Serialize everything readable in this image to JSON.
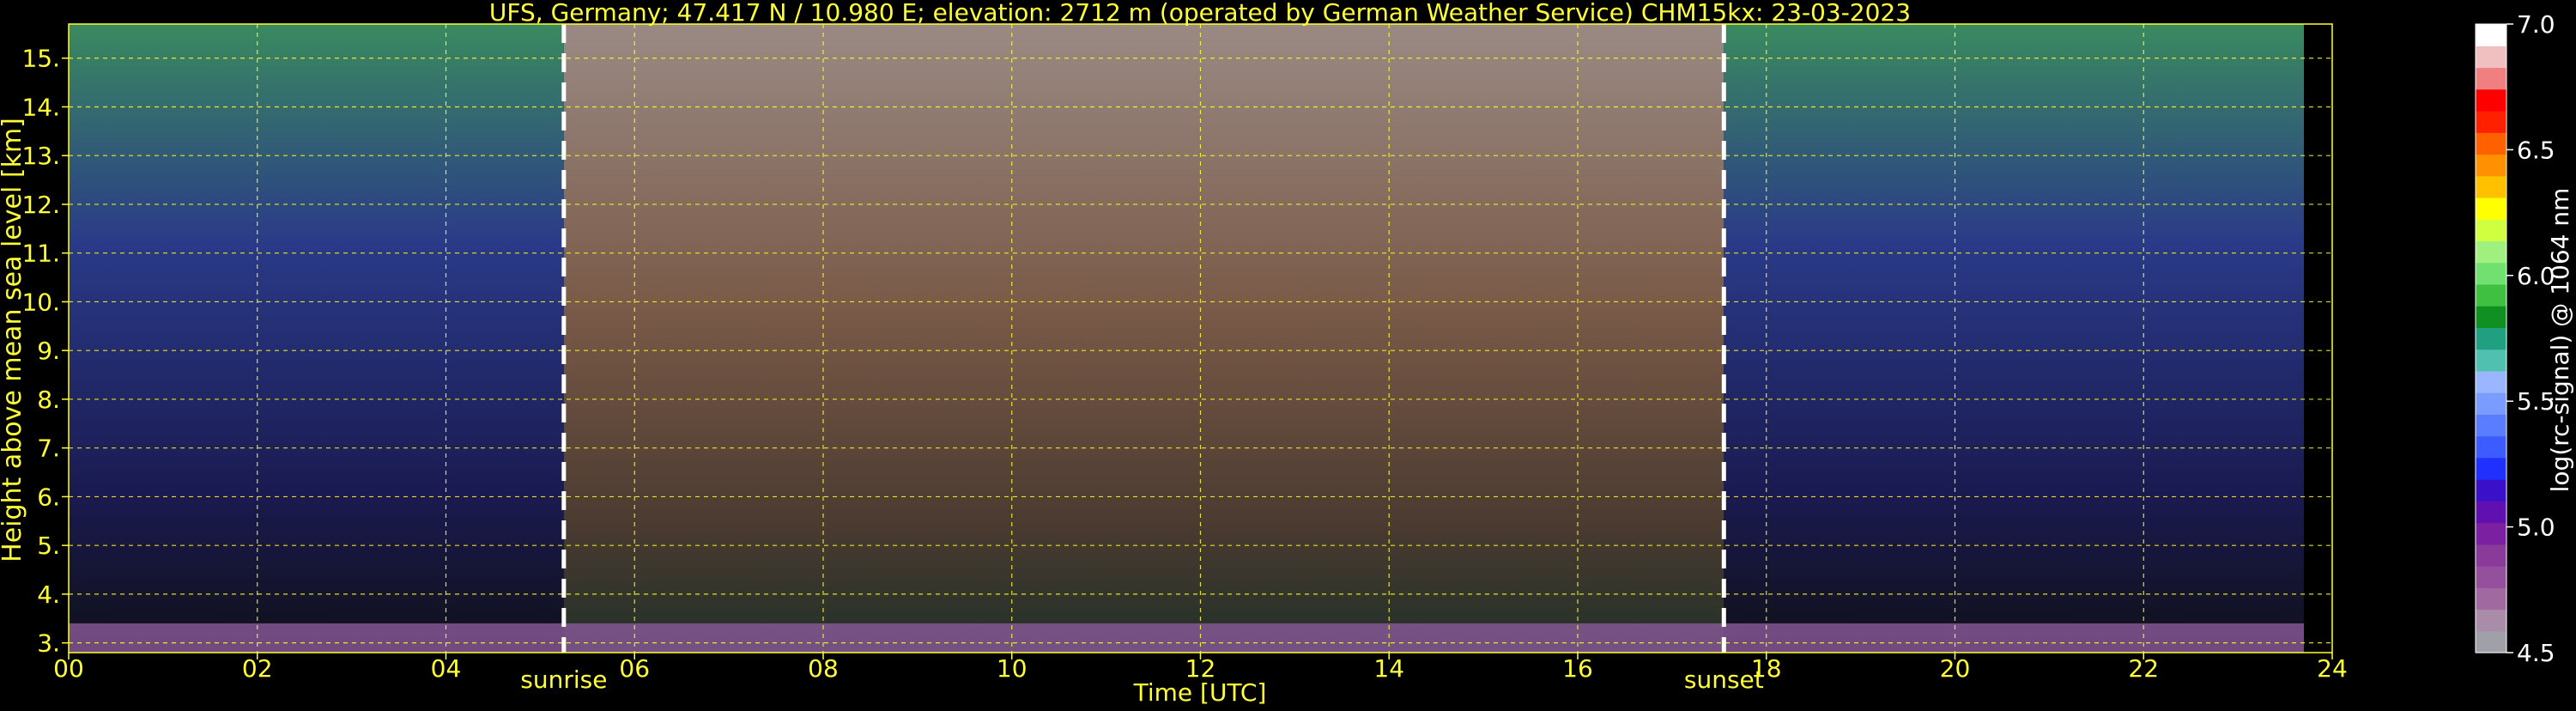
{
  "chart_data": {
    "type": "heatmap",
    "title": "UFS, Germany; 47.417 N / 10.980 E; elevation: 2712 m  (operated by German Weather Service)    CHM15kx: 23-03-2023",
    "xlabel": "Time [UTC]",
    "ylabel": "Height above mean sea level [km]",
    "xlim": [
      0,
      24
    ],
    "ylim": [
      2.8,
      15.7
    ],
    "x_ticks": [
      "00",
      "02",
      "04",
      "06",
      "08",
      "10",
      "12",
      "14",
      "16",
      "18",
      "20",
      "22",
      "24"
    ],
    "y_ticks": [
      "3.",
      "4.",
      "5.",
      "6.",
      "7.",
      "8.",
      "9.",
      "10.",
      "11.",
      "12.",
      "13.",
      "14.",
      "15."
    ],
    "grid": true,
    "data_end_hour": 23.7,
    "events": [
      {
        "label": "sunrise",
        "hour": 5.25
      },
      {
        "label": "sunset",
        "hour": 17.55
      }
    ],
    "colorbar": {
      "label": "log(rc-signal) @ 1064 nm",
      "range": [
        4.5,
        7.0
      ],
      "ticks": [
        "4.5",
        "5.0",
        "5.5",
        "6.0",
        "6.5",
        "7.0"
      ],
      "colors": [
        "#a0a0a8",
        "#a88ca8",
        "#a06aa0",
        "#94509c",
        "#8a3a98",
        "#7a20a0",
        "#6010b0",
        "#3a10c8",
        "#2030ff",
        "#3c5cff",
        "#5a7cff",
        "#7a9cff",
        "#9ab6ff",
        "#50c0b0",
        "#20a080",
        "#109020",
        "#40c040",
        "#70e070",
        "#a0f080",
        "#d0ff40",
        "#ffff00",
        "#ffc000",
        "#ff9000",
        "#ff6000",
        "#ff2000",
        "#ff0000",
        "#f08080",
        "#f0c0c0",
        "#ffffff"
      ]
    }
  }
}
